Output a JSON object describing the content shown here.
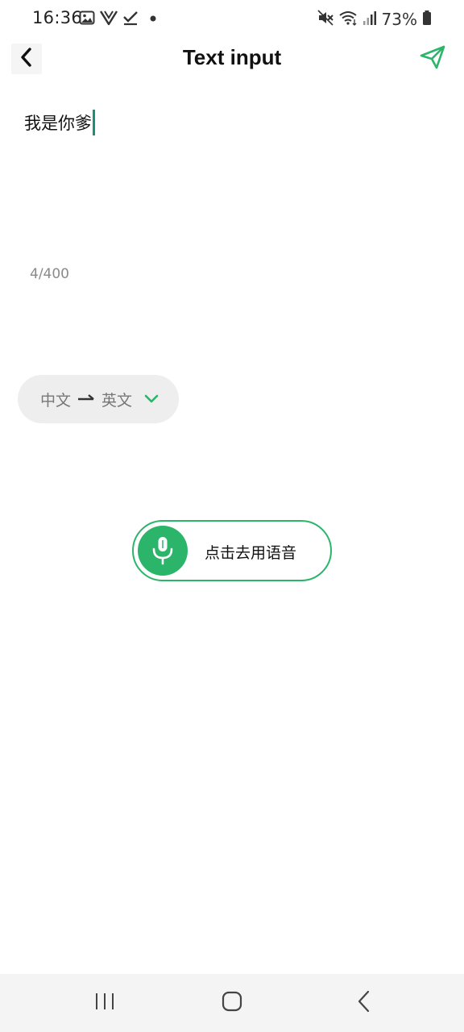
{
  "status_bar": {
    "time": "16:36",
    "battery_percent": "73%",
    "icons_left": [
      "gallery-icon",
      "vpn-v-icon",
      "check-download-icon",
      "dot-icon"
    ],
    "icons_right": [
      "mute-icon",
      "wifi-icon",
      "signal-icon",
      "battery-icon"
    ]
  },
  "app_bar": {
    "title": "Text input",
    "back_icon": "chevron-left-icon",
    "send_icon": "paper-plane-icon"
  },
  "editor": {
    "text": "我是你爹",
    "char_count": "4/400"
  },
  "language": {
    "source": "中文",
    "target": "英文",
    "arrow_icon": "arrow-right-icon",
    "dropdown_icon": "chevron-down-icon"
  },
  "voice": {
    "label": "点击去用语音",
    "icon": "microphone-icon"
  },
  "colors": {
    "accent_green": "#2bb56a",
    "caret_teal": "#1a8f7a",
    "pill_gray": "#eeeeee",
    "nav_bg": "#f4f4f4"
  },
  "nav_bar": {
    "buttons": [
      "recents-icon",
      "home-icon",
      "back-icon"
    ]
  }
}
